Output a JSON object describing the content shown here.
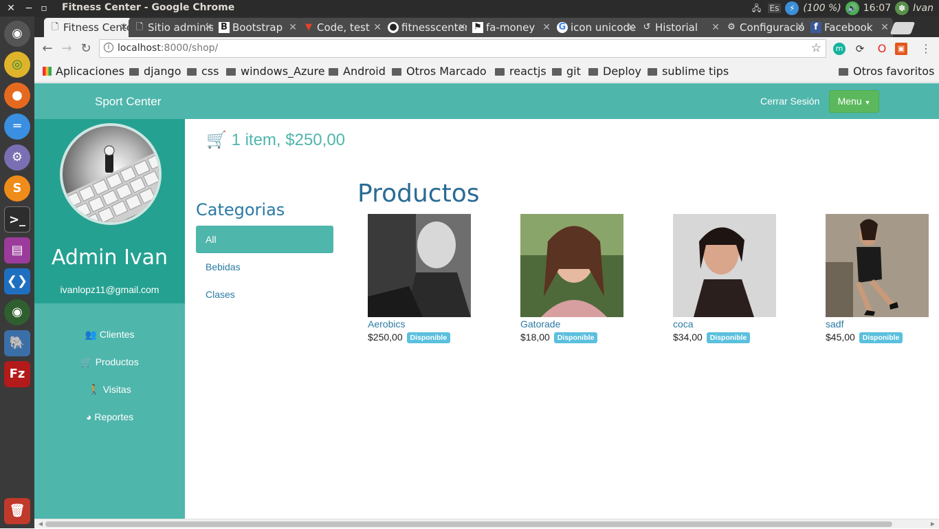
{
  "window": {
    "title": "Fitness Center - Google Chrome",
    "tray": {
      "battery": "(100 %)",
      "time": "16:07",
      "user": "Ivan",
      "keyboard": "Es"
    }
  },
  "tabs": [
    {
      "label": "Fitness Center",
      "icon": "page-icon"
    },
    {
      "label": "Sitio administrativo",
      "icon": "page-icon"
    },
    {
      "label": "Bootstrap",
      "icon": "bootstrap-icon"
    },
    {
      "label": "Code, test",
      "icon": "gitlab-icon"
    },
    {
      "label": "fitnesscenter",
      "icon": "github-icon"
    },
    {
      "label": "fa-money",
      "icon": "flag-icon"
    },
    {
      "label": "icon unicode",
      "icon": "google-icon"
    },
    {
      "label": "Historial",
      "icon": "history-icon"
    },
    {
      "label": "Configuración",
      "icon": "gear-icon"
    },
    {
      "label": "Facebook",
      "icon": "facebook-icon"
    }
  ],
  "toolbar": {
    "url_host": "localhost",
    "url_rest": ":8000/shop/"
  },
  "bookmarks": {
    "apps": "Aplicaciones",
    "items": [
      "django",
      "css",
      "windows_Azure",
      "Android",
      "Otros Marcadores",
      "reactjs",
      "git",
      "Deploy",
      "sublime tips"
    ],
    "other": "Otros favoritos"
  },
  "navbar": {
    "brand": "Sport Center",
    "logout": "Cerrar Sesión",
    "menu": "Menu"
  },
  "sidebar": {
    "name": "Admin Ivan",
    "email": "ivanlopz11@gmail.com",
    "items": [
      {
        "label": "Clientes",
        "icon": "users-icon"
      },
      {
        "label": "Productos",
        "icon": "cart-icon"
      },
      {
        "label": "Visitas",
        "icon": "male-icon"
      },
      {
        "label": "Reportes",
        "icon": "pie-chart-icon"
      }
    ]
  },
  "cart": {
    "text": "1 item, $250,00"
  },
  "categories": {
    "heading": "Categorias",
    "items": [
      "All",
      "Bebidas",
      "Clases"
    ]
  },
  "products": {
    "heading": "Productos",
    "items": [
      {
        "name": "Aerobics",
        "price": "$250,00",
        "badge": "Disponible"
      },
      {
        "name": "Gatorade",
        "price": "$18,00",
        "badge": "Disponible"
      },
      {
        "name": "coca",
        "price": "$34,00",
        "badge": "Disponible"
      },
      {
        "name": "sadf",
        "price": "$45,00",
        "badge": "Disponible"
      }
    ]
  },
  "colors": {
    "accent": "#4fb6ac",
    "profile": "#25a191",
    "menu_btn": "#5cb85c",
    "badge": "#5bc0de"
  }
}
